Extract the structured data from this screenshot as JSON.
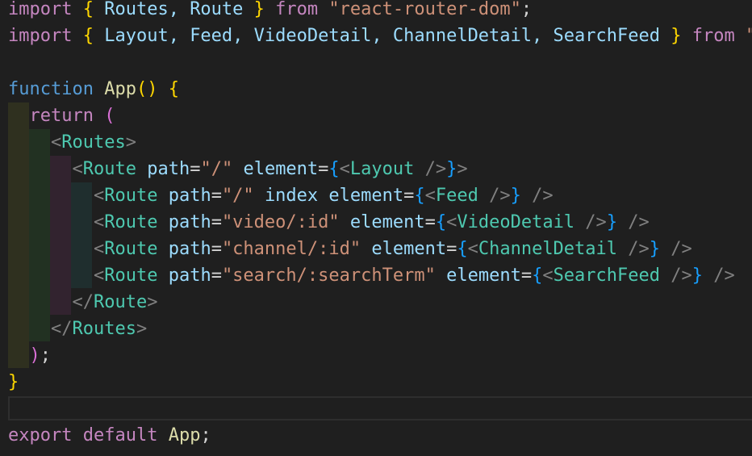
{
  "colors": {
    "background": "#1f1f1f",
    "keyword_control": "#c586c0",
    "keyword_storage": "#569cd6",
    "variable": "#9cdcfe",
    "function": "#dcdcaa",
    "string": "#ce9178",
    "tag_bracket": "#808080",
    "component": "#4ec9b0",
    "bracket_gold": "#ffd700",
    "bracket_blue": "#179fff",
    "bracket_pink": "#da70d6",
    "plain": "#d4d4d4"
  },
  "code_lines": [
    [
      {
        "t": "import",
        "c": "keyword_control"
      },
      {
        "t": " ",
        "c": "plain"
      },
      {
        "t": "{",
        "c": "bracket_gold"
      },
      {
        "t": " Routes, Route ",
        "c": "variable"
      },
      {
        "t": "}",
        "c": "bracket_gold"
      },
      {
        "t": " ",
        "c": "plain"
      },
      {
        "t": "from",
        "c": "keyword_control"
      },
      {
        "t": " ",
        "c": "plain"
      },
      {
        "t": "\"react-router-dom\"",
        "c": "string"
      },
      {
        "t": ";",
        "c": "plain"
      }
    ],
    [
      {
        "t": "import",
        "c": "keyword_control"
      },
      {
        "t": " ",
        "c": "plain"
      },
      {
        "t": "{",
        "c": "bracket_gold"
      },
      {
        "t": " Layout, Feed, VideoDetail, ChannelDetail, SearchFeed ",
        "c": "variable"
      },
      {
        "t": "}",
        "c": "bracket_gold"
      },
      {
        "t": " ",
        "c": "plain"
      },
      {
        "t": "from",
        "c": "keyword_control"
      },
      {
        "t": " \"",
        "c": "string"
      }
    ],
    [],
    [
      {
        "t": "function",
        "c": "keyword_storage"
      },
      {
        "t": " ",
        "c": "plain"
      },
      {
        "t": "App",
        "c": "function"
      },
      {
        "t": "()",
        "c": "bracket_gold"
      },
      {
        "t": " ",
        "c": "plain"
      },
      {
        "t": "{",
        "c": "bracket_gold"
      }
    ],
    [
      {
        "t": "  ",
        "c": "plain"
      },
      {
        "t": "return",
        "c": "keyword_control"
      },
      {
        "t": " ",
        "c": "plain"
      },
      {
        "t": "(",
        "c": "bracket_pink"
      }
    ],
    [
      {
        "t": "    ",
        "c": "plain"
      },
      {
        "t": "<",
        "c": "tag_bracket"
      },
      {
        "t": "Routes",
        "c": "component"
      },
      {
        "t": ">",
        "c": "tag_bracket"
      }
    ],
    [
      {
        "t": "      ",
        "c": "plain"
      },
      {
        "t": "<",
        "c": "tag_bracket"
      },
      {
        "t": "Route",
        "c": "component"
      },
      {
        "t": " ",
        "c": "plain"
      },
      {
        "t": "path",
        "c": "variable"
      },
      {
        "t": "=",
        "c": "plain"
      },
      {
        "t": "\"/\"",
        "c": "string"
      },
      {
        "t": " ",
        "c": "plain"
      },
      {
        "t": "element",
        "c": "variable"
      },
      {
        "t": "=",
        "c": "plain"
      },
      {
        "t": "{",
        "c": "bracket_blue"
      },
      {
        "t": "<",
        "c": "tag_bracket"
      },
      {
        "t": "Layout",
        "c": "component"
      },
      {
        "t": " />",
        "c": "tag_bracket"
      },
      {
        "t": "}",
        "c": "bracket_blue"
      },
      {
        "t": ">",
        "c": "tag_bracket"
      }
    ],
    [
      {
        "t": "        ",
        "c": "plain"
      },
      {
        "t": "<",
        "c": "tag_bracket"
      },
      {
        "t": "Route",
        "c": "component"
      },
      {
        "t": " ",
        "c": "plain"
      },
      {
        "t": "path",
        "c": "variable"
      },
      {
        "t": "=",
        "c": "plain"
      },
      {
        "t": "\"/\"",
        "c": "string"
      },
      {
        "t": " ",
        "c": "plain"
      },
      {
        "t": "index",
        "c": "variable"
      },
      {
        "t": " ",
        "c": "plain"
      },
      {
        "t": "element",
        "c": "variable"
      },
      {
        "t": "=",
        "c": "plain"
      },
      {
        "t": "{",
        "c": "bracket_blue"
      },
      {
        "t": "<",
        "c": "tag_bracket"
      },
      {
        "t": "Feed",
        "c": "component"
      },
      {
        "t": " />",
        "c": "tag_bracket"
      },
      {
        "t": "}",
        "c": "bracket_blue"
      },
      {
        "t": " />",
        "c": "tag_bracket"
      }
    ],
    [
      {
        "t": "        ",
        "c": "plain"
      },
      {
        "t": "<",
        "c": "tag_bracket"
      },
      {
        "t": "Route",
        "c": "component"
      },
      {
        "t": " ",
        "c": "plain"
      },
      {
        "t": "path",
        "c": "variable"
      },
      {
        "t": "=",
        "c": "plain"
      },
      {
        "t": "\"video/:id\"",
        "c": "string"
      },
      {
        "t": " ",
        "c": "plain"
      },
      {
        "t": "element",
        "c": "variable"
      },
      {
        "t": "=",
        "c": "plain"
      },
      {
        "t": "{",
        "c": "bracket_blue"
      },
      {
        "t": "<",
        "c": "tag_bracket"
      },
      {
        "t": "VideoDetail",
        "c": "component"
      },
      {
        "t": " />",
        "c": "tag_bracket"
      },
      {
        "t": "}",
        "c": "bracket_blue"
      },
      {
        "t": " />",
        "c": "tag_bracket"
      }
    ],
    [
      {
        "t": "        ",
        "c": "plain"
      },
      {
        "t": "<",
        "c": "tag_bracket"
      },
      {
        "t": "Route",
        "c": "component"
      },
      {
        "t": " ",
        "c": "plain"
      },
      {
        "t": "path",
        "c": "variable"
      },
      {
        "t": "=",
        "c": "plain"
      },
      {
        "t": "\"channel/:id\"",
        "c": "string"
      },
      {
        "t": " ",
        "c": "plain"
      },
      {
        "t": "element",
        "c": "variable"
      },
      {
        "t": "=",
        "c": "plain"
      },
      {
        "t": "{",
        "c": "bracket_blue"
      },
      {
        "t": "<",
        "c": "tag_bracket"
      },
      {
        "t": "ChannelDetail",
        "c": "component"
      },
      {
        "t": " />",
        "c": "tag_bracket"
      },
      {
        "t": "}",
        "c": "bracket_blue"
      },
      {
        "t": " />",
        "c": "tag_bracket"
      }
    ],
    [
      {
        "t": "        ",
        "c": "plain"
      },
      {
        "t": "<",
        "c": "tag_bracket"
      },
      {
        "t": "Route",
        "c": "component"
      },
      {
        "t": " ",
        "c": "plain"
      },
      {
        "t": "path",
        "c": "variable"
      },
      {
        "t": "=",
        "c": "plain"
      },
      {
        "t": "\"search/:searchTerm\"",
        "c": "string"
      },
      {
        "t": " ",
        "c": "plain"
      },
      {
        "t": "element",
        "c": "variable"
      },
      {
        "t": "=",
        "c": "plain"
      },
      {
        "t": "{",
        "c": "bracket_blue"
      },
      {
        "t": "<",
        "c": "tag_bracket"
      },
      {
        "t": "SearchFeed",
        "c": "component"
      },
      {
        "t": " />",
        "c": "tag_bracket"
      },
      {
        "t": "}",
        "c": "bracket_blue"
      },
      {
        "t": " />",
        "c": "tag_bracket"
      }
    ],
    [
      {
        "t": "      ",
        "c": "plain"
      },
      {
        "t": "</",
        "c": "tag_bracket"
      },
      {
        "t": "Route",
        "c": "component"
      },
      {
        "t": ">",
        "c": "tag_bracket"
      }
    ],
    [
      {
        "t": "    ",
        "c": "plain"
      },
      {
        "t": "</",
        "c": "tag_bracket"
      },
      {
        "t": "Routes",
        "c": "component"
      },
      {
        "t": ">",
        "c": "tag_bracket"
      }
    ],
    [
      {
        "t": "  ",
        "c": "plain"
      },
      {
        "t": ")",
        "c": "bracket_pink"
      },
      {
        "t": ";",
        "c": "plain"
      }
    ],
    [
      {
        "t": "}",
        "c": "bracket_gold"
      }
    ],
    [],
    [
      {
        "t": "export",
        "c": "keyword_control"
      },
      {
        "t": " ",
        "c": "plain"
      },
      {
        "t": "default",
        "c": "keyword_control"
      },
      {
        "t": " ",
        "c": "plain"
      },
      {
        "t": "App",
        "c": "function"
      },
      {
        "t": ";",
        "c": "plain"
      }
    ]
  ]
}
